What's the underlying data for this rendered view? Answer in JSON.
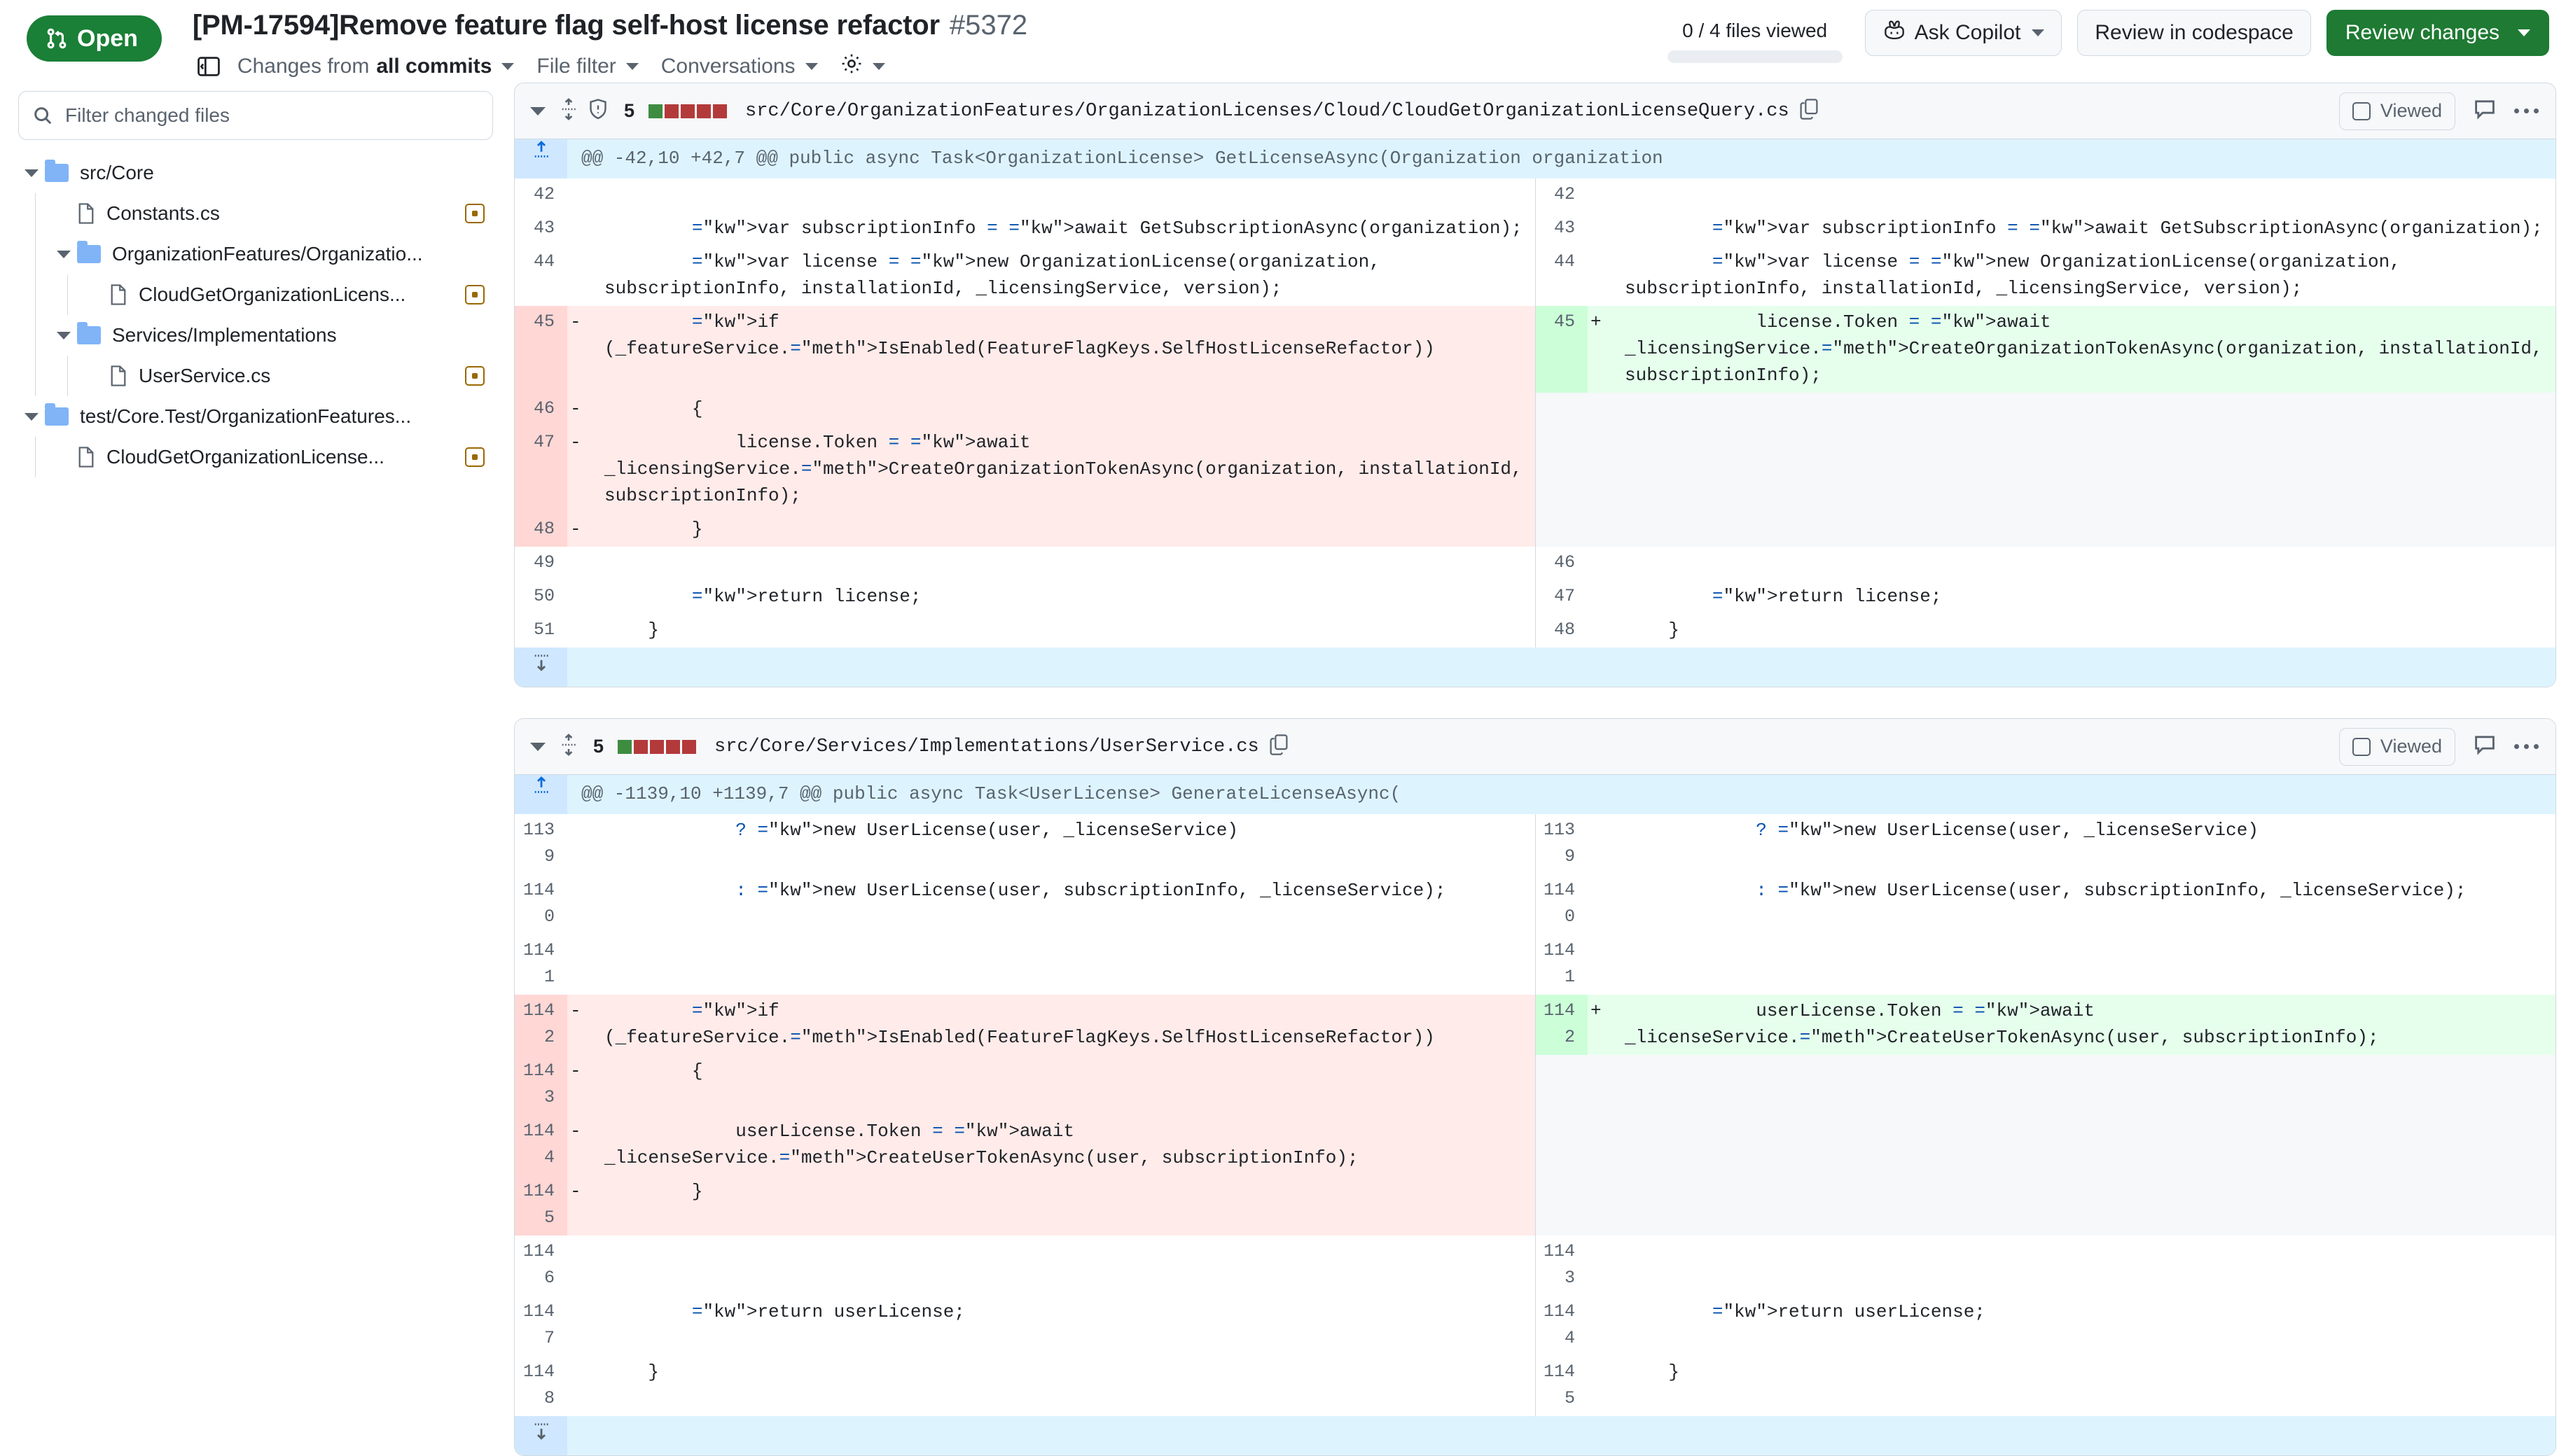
{
  "header": {
    "state_badge": "Open",
    "pr_title": "[PM-17594]Remove feature flag self-host license refactor",
    "pr_number": "#5372",
    "subnav": {
      "sidebar_toggle_icon": "sidebar-collapse-icon",
      "changes_from_prefix": "Changes from ",
      "changes_from_value": "all commits",
      "file_filter": "File filter",
      "conversations": "Conversations",
      "settings_icon": "gear-icon"
    },
    "files_viewed": "0 / 4 files viewed",
    "ask_copilot": "Ask Copilot",
    "review_in_codespace": "Review in codespace",
    "review_changes": "Review changes",
    "accent_green": "#1a7f37"
  },
  "sidebar": {
    "filter_placeholder": "Filter changed files",
    "tree": [
      {
        "type": "folder",
        "label": "src/Core",
        "depth": 0
      },
      {
        "type": "file",
        "label": "Constants.cs",
        "depth": 1,
        "badge": "modified"
      },
      {
        "type": "folder",
        "label": "OrganizationFeatures/Organizatio...",
        "depth": 1
      },
      {
        "type": "file",
        "label": "CloudGetOrganizationLicens...",
        "depth": 2,
        "badge": "modified"
      },
      {
        "type": "folder",
        "label": "Services/Implementations",
        "depth": 1
      },
      {
        "type": "file",
        "label": "UserService.cs",
        "depth": 2,
        "badge": "modified"
      },
      {
        "type": "folder",
        "label": "test/Core.Test/OrganizationFeatures...",
        "depth": 0
      },
      {
        "type": "file",
        "label": "CloudGetOrganizationLicense...",
        "depth": 1,
        "badge": "modified"
      }
    ]
  },
  "files": [
    {
      "diffstat_count": "5",
      "diffstat_blocks": [
        "add",
        "del",
        "del",
        "del",
        "del"
      ],
      "path": "src/Core/OrganizationFeatures/OrganizationLicenses/Cloud/CloudGetOrganizationLicenseQuery.cs",
      "has_shield_icon": true,
      "viewed_label": "Viewed",
      "hunk": "@@ -42,10 +42,7 @@ public async Task<OrganizationLicense> GetLicenseAsync(Organization organization",
      "rows": [
        {
          "kind": "ctx",
          "lnum_left": "42",
          "left": "",
          "lnum_right": "42",
          "right": ""
        },
        {
          "kind": "ctx",
          "lnum_left": "43",
          "left": "        var subscriptionInfo = await GetSubscriptionAsync(organization);",
          "lnum_right": "43",
          "right": "        var subscriptionInfo = await GetSubscriptionAsync(organization);"
        },
        {
          "kind": "ctx",
          "lnum_left": "44",
          "left": "        var license = new OrganizationLicense(organization, subscriptionInfo, installationId, _licensingService, version);",
          "lnum_right": "44",
          "right": "        var license = new OrganizationLicense(organization, subscriptionInfo, installationId, _licensingService, version);"
        },
        {
          "kind": "change",
          "lnum_left": "45",
          "left_sign": "-",
          "left": "        if (_featureService.IsEnabled(FeatureFlagKeys.SelfHostLicenseRefactor))",
          "lnum_right": "45",
          "right_sign": "+",
          "right": "            license.Token = await _licensingService.CreateOrganizationTokenAsync(organization, installationId, subscriptionInfo);"
        },
        {
          "kind": "del",
          "lnum_left": "46",
          "left_sign": "-",
          "left": "        {"
        },
        {
          "kind": "del",
          "lnum_left": "47",
          "left_sign": "-",
          "left": "            license.Token = await _licensingService.CreateOrganizationTokenAsync(organization, installationId, subscriptionInfo);"
        },
        {
          "kind": "del",
          "lnum_left": "48",
          "left_sign": "-",
          "left": "        }"
        },
        {
          "kind": "ctx",
          "lnum_left": "49",
          "left": "",
          "lnum_right": "46",
          "right": ""
        },
        {
          "kind": "ctx",
          "lnum_left": "50",
          "left": "        return license;",
          "lnum_right": "47",
          "right": "        return license;"
        },
        {
          "kind": "ctx",
          "lnum_left": "51",
          "left": "    }",
          "lnum_right": "48",
          "right": "    }"
        }
      ]
    },
    {
      "diffstat_count": "5",
      "diffstat_blocks": [
        "add",
        "del",
        "del",
        "del",
        "del"
      ],
      "path": "src/Core/Services/Implementations/UserService.cs",
      "has_shield_icon": false,
      "viewed_label": "Viewed",
      "hunk": "@@ -1139,10 +1139,7 @@ public async Task<UserLicense> GenerateLicenseAsync(",
      "rows": [
        {
          "kind": "ctx",
          "lnum_left": "1139",
          "left": "            ? new UserLicense(user, _licenseService)",
          "lnum_right": "1139",
          "right": "            ? new UserLicense(user, _licenseService)"
        },
        {
          "kind": "ctx",
          "lnum_left": "1140",
          "left": "            : new UserLicense(user, subscriptionInfo, _licenseService);",
          "lnum_right": "1140",
          "right": "            : new UserLicense(user, subscriptionInfo, _licenseService);"
        },
        {
          "kind": "ctx",
          "lnum_left": "1141",
          "left": "",
          "lnum_right": "1141",
          "right": ""
        },
        {
          "kind": "change",
          "lnum_left": "1142",
          "left_sign": "-",
          "left": "        if (_featureService.IsEnabled(FeatureFlagKeys.SelfHostLicenseRefactor))",
          "lnum_right": "1142",
          "right_sign": "+",
          "right": "            userLicense.Token = await _licenseService.CreateUserTokenAsync(user, subscriptionInfo);"
        },
        {
          "kind": "del",
          "lnum_left": "1143",
          "left_sign": "-",
          "left": "        {"
        },
        {
          "kind": "del",
          "lnum_left": "1144",
          "left_sign": "-",
          "left": "            userLicense.Token = await _licenseService.CreateUserTokenAsync(user, subscriptionInfo);"
        },
        {
          "kind": "del",
          "lnum_left": "1145",
          "left_sign": "-",
          "left": "        }"
        },
        {
          "kind": "ctx",
          "lnum_left": "1146",
          "left": "",
          "lnum_right": "1143",
          "right": ""
        },
        {
          "kind": "ctx",
          "lnum_left": "1147",
          "left": "        return userLicense;",
          "lnum_right": "1144",
          "right": "        return userLicense;"
        },
        {
          "kind": "ctx",
          "lnum_left": "1148",
          "left": "    }",
          "lnum_right": "1145",
          "right": "    }"
        }
      ]
    }
  ]
}
